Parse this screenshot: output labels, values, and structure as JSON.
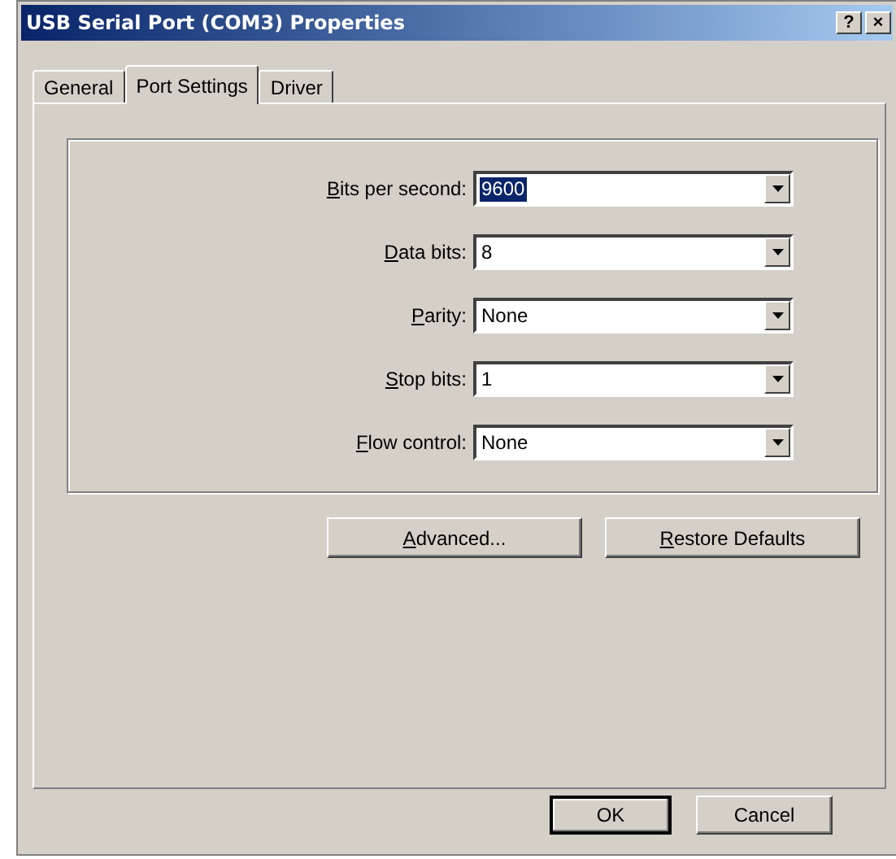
{
  "window": {
    "title": "USB Serial Port (COM3) Properties",
    "title_buttons": [
      "?",
      "×"
    ]
  },
  "tabs": [
    {
      "label": "General",
      "selected": false
    },
    {
      "label": "Port Settings",
      "selected": true
    },
    {
      "label": "Driver",
      "selected": false
    }
  ],
  "fields": [
    {
      "label": "Bits per second:",
      "first_letter_underlined": true,
      "value": "9600",
      "focused": true
    },
    {
      "label": "Data bits:",
      "first_letter_underlined": true,
      "value": "8",
      "focused": false
    },
    {
      "label": "Parity:",
      "first_letter_underlined": true,
      "value": "None",
      "focused": false
    },
    {
      "label": "Stop bits:",
      "first_letter_underlined": true,
      "value": "1",
      "focused": false
    },
    {
      "label": "Flow control:",
      "first_letter_underlined": true,
      "value": "None",
      "focused": false
    }
  ],
  "panel_buttons": [
    {
      "label": "Advanced...",
      "first_letter_underlined": true
    },
    {
      "label": "Restore Defaults",
      "first_letter_underlined": true
    }
  ],
  "dialog_buttons": [
    {
      "label": "OK",
      "default": true
    },
    {
      "label": "Cancel",
      "default": false
    }
  ]
}
